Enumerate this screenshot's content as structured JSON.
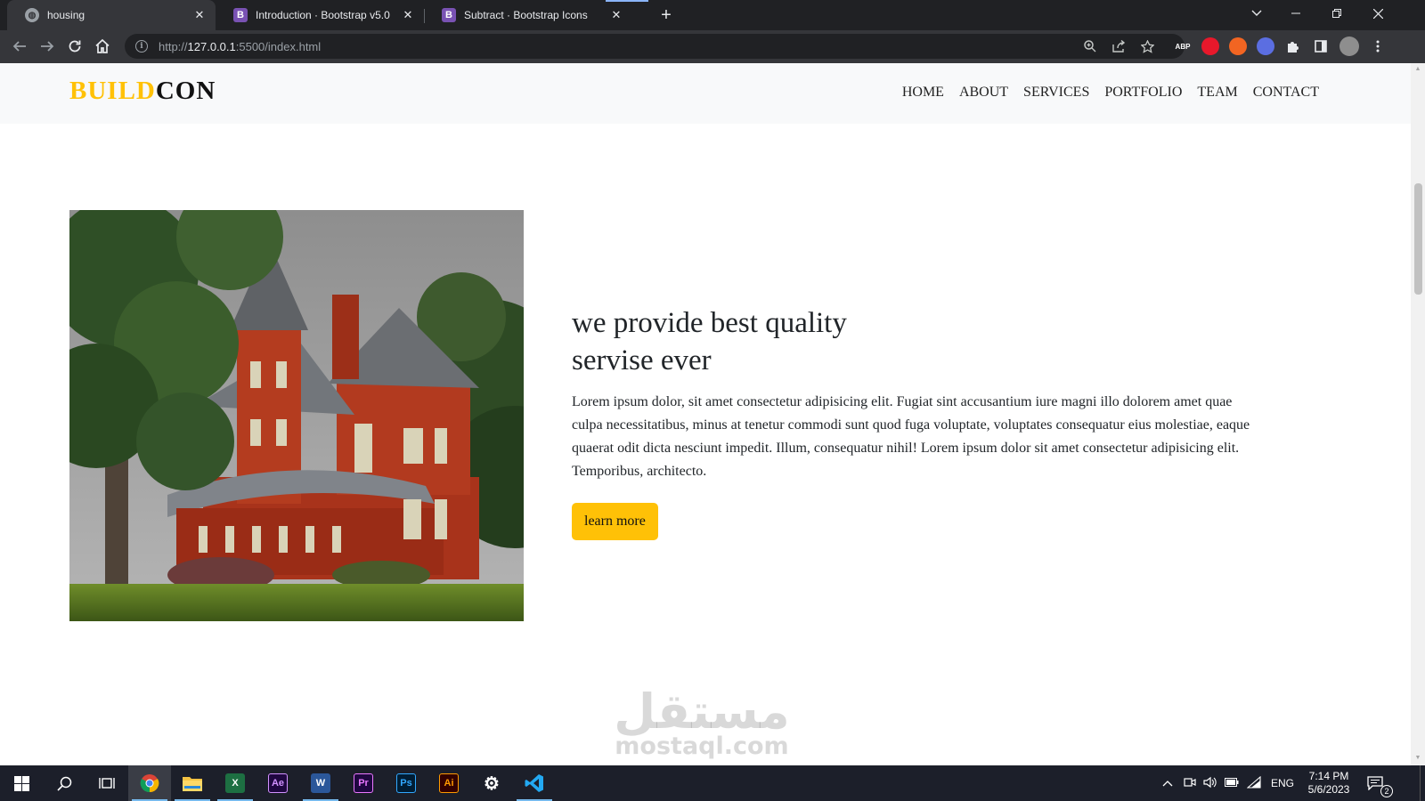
{
  "browser": {
    "tabs": [
      {
        "title": "housing",
        "favicon": "globe-icon",
        "active": true
      },
      {
        "title": "Introduction · Bootstrap v5.0",
        "favicon": "bootstrap-icon",
        "active": false
      },
      {
        "title": "Subtract · Bootstrap Icons",
        "favicon": "bootstrap-icon",
        "active": false
      }
    ],
    "tab_close_glyph": "✕",
    "new_tab_glyph": "+",
    "url_prefix": "http://",
    "url_host": "127.0.0.1",
    "url_rest": ":5500/index.html",
    "extensions": [
      {
        "name": "adblock-plus-icon",
        "label": "ABP",
        "color": "#e2263f"
      },
      {
        "name": "red-extension-icon",
        "label": "",
        "color": "#e8182b"
      },
      {
        "name": "orange-extension-icon",
        "label": "",
        "color": "#f26522"
      },
      {
        "name": "blue-extension-icon",
        "label": "",
        "color": "#5b6ee1"
      }
    ]
  },
  "site": {
    "brand_part1": "BUILD",
    "brand_part2": "CON",
    "brand_accent": "#ffc107",
    "nav": [
      "HOME",
      "ABOUT",
      "SERVICES",
      "PORTFOLIO",
      "TEAM",
      "CONTACT"
    ],
    "heading": "we provide best quality servise ever",
    "body": "Lorem ipsum dolor, sit amet consectetur adipisicing elit. Fugiat sint accusantium iure magni illo dolorem amet quae culpa necessitatibus, minus at tenetur commodi sunt quod fuga voluptate, voluptates consequatur eius molestiae, eaque quaerat odit dicta nesciunt impedit. Illum, consequatur nihil! Lorem ipsum dolor sit amet consectetur adipisicing elit. Temporibus, architecto.",
    "cta": "learn more"
  },
  "watermark": {
    "arabic": "مستقل",
    "latin": "mostaql.com"
  },
  "taskbar": {
    "apps": [
      {
        "name": "chrome-icon",
        "label": "",
        "bg": "#1c1f2a"
      },
      {
        "name": "file-explorer-icon",
        "label": "",
        "bg": "#f6c343"
      },
      {
        "name": "excel-icon",
        "label": "X",
        "bg": "#1d6f42"
      },
      {
        "name": "after-effects-icon",
        "label": "Ae",
        "bg": "#1f0740"
      },
      {
        "name": "word-icon",
        "label": "W",
        "bg": "#2b579a"
      },
      {
        "name": "premiere-icon",
        "label": "Pr",
        "bg": "#1f0740"
      },
      {
        "name": "photoshop-icon",
        "label": "Ps",
        "bg": "#001d34"
      },
      {
        "name": "illustrator-icon",
        "label": "Ai",
        "bg": "#330000"
      },
      {
        "name": "settings-icon",
        "label": "⚙",
        "bg": "transparent"
      },
      {
        "name": "vscode-icon",
        "label": "",
        "bg": "transparent"
      }
    ],
    "language": "ENG",
    "time": "7:14 PM",
    "date": "5/6/2023",
    "notifications": "2"
  }
}
